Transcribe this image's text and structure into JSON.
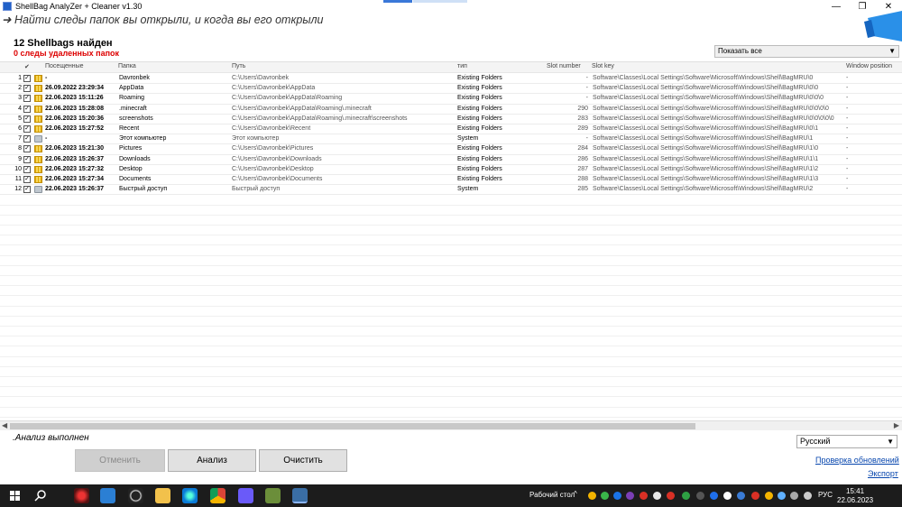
{
  "window": {
    "title": "ShellBag  AnalyZer + Cleaner v1.30",
    "minimize": "—",
    "maximize": "❐",
    "close": "✕"
  },
  "tagline": "➜ Найти следы папок вы открыли, и когда вы его открыли",
  "summary": {
    "found": "12 Shellbags найден",
    "deleted": "0  следы удаленных папок"
  },
  "filter": {
    "selected": "Показать все"
  },
  "grid": {
    "columns": {
      "check": "✔",
      "visited": "Посещенные",
      "folder": "Папка",
      "path": "Путь",
      "type": "тип",
      "slot_number": "Slot number",
      "slot_key": "Slot key",
      "window_position": "Window position"
    },
    "rows": [
      {
        "num": "1",
        "icon": "folder",
        "visited": "-",
        "folder": "Davronbek",
        "path": "C:\\Users\\Davronbek",
        "type": "Existing Folders",
        "slot": "-",
        "key": "Software\\Classes\\Local Settings\\Software\\Microsoft\\Windows\\Shell\\BagMRU\\0",
        "pos": "-"
      },
      {
        "num": "2",
        "icon": "folder",
        "visited": "26.09.2022 23:29:34",
        "folder": "AppData",
        "path": "C:\\Users\\Davronbek\\AppData",
        "type": "Existing Folders",
        "slot": "-",
        "key": "Software\\Classes\\Local Settings\\Software\\Microsoft\\Windows\\Shell\\BagMRU\\0\\0",
        "pos": "-"
      },
      {
        "num": "3",
        "icon": "folder",
        "visited": "22.06.2023 15:11:26",
        "folder": "Roaming",
        "path": "C:\\Users\\Davronbek\\AppData\\Roaming",
        "type": "Existing Folders",
        "slot": "-",
        "key": "Software\\Classes\\Local Settings\\Software\\Microsoft\\Windows\\Shell\\BagMRU\\0\\0\\0",
        "pos": "-"
      },
      {
        "num": "4",
        "icon": "folder",
        "visited": "22.06.2023 15:28:08",
        "folder": ".minecraft",
        "path": "C:\\Users\\Davronbek\\AppData\\Roaming\\.minecraft",
        "type": "Existing Folders",
        "slot": "290",
        "key": "Software\\Classes\\Local Settings\\Software\\Microsoft\\Windows\\Shell\\BagMRU\\0\\0\\0\\0",
        "pos": "-"
      },
      {
        "num": "5",
        "icon": "folder",
        "visited": "22.06.2023 15:20:36",
        "folder": "screenshots",
        "path": "C:\\Users\\Davronbek\\AppData\\Roaming\\.minecraft\\screenshots",
        "type": "Existing Folders",
        "slot": "283",
        "key": "Software\\Classes\\Local Settings\\Software\\Microsoft\\Windows\\Shell\\BagMRU\\0\\0\\0\\0\\0",
        "pos": "-"
      },
      {
        "num": "6",
        "icon": "folder",
        "visited": "22.06.2023 15:27:52",
        "folder": "Recent",
        "path": "C:\\Users\\Davronbek\\Recent",
        "type": "Existing Folders",
        "slot": "289",
        "key": "Software\\Classes\\Local Settings\\Software\\Microsoft\\Windows\\Shell\\BagMRU\\0\\1",
        "pos": "-"
      },
      {
        "num": "7",
        "icon": "sys",
        "visited": "-",
        "folder": "Этот компьютер",
        "path": "Этот компьютер",
        "type": "System",
        "slot": "-",
        "key": "Software\\Classes\\Local Settings\\Software\\Microsoft\\Windows\\Shell\\BagMRU\\1",
        "pos": "-"
      },
      {
        "num": "8",
        "icon": "folder",
        "visited": "22.06.2023 15:21:30",
        "folder": "Pictures",
        "path": "C:\\Users\\Davronbek\\Pictures",
        "type": "Existing Folders",
        "slot": "284",
        "key": "Software\\Classes\\Local Settings\\Software\\Microsoft\\Windows\\Shell\\BagMRU\\1\\0",
        "pos": "-"
      },
      {
        "num": "9",
        "icon": "folder",
        "visited": "22.06.2023 15:26:37",
        "folder": "Downloads",
        "path": "C:\\Users\\Davronbek\\Downloads",
        "type": "Existing Folders",
        "slot": "286",
        "key": "Software\\Classes\\Local Settings\\Software\\Microsoft\\Windows\\Shell\\BagMRU\\1\\1",
        "pos": "-"
      },
      {
        "num": "10",
        "icon": "folder",
        "visited": "22.06.2023 15:27:32",
        "folder": "Desktop",
        "path": "C:\\Users\\Davronbek\\Desktop",
        "type": "Existing Folders",
        "slot": "287",
        "key": "Software\\Classes\\Local Settings\\Software\\Microsoft\\Windows\\Shell\\BagMRU\\1\\2",
        "pos": "-"
      },
      {
        "num": "11",
        "icon": "folder",
        "visited": "22.06.2023 15:27:34",
        "folder": "Documents",
        "path": "C:\\Users\\Davronbek\\Documents",
        "type": "Existing Folders",
        "slot": "288",
        "key": "Software\\Classes\\Local Settings\\Software\\Microsoft\\Windows\\Shell\\BagMRU\\1\\3",
        "pos": "-"
      },
      {
        "num": "12",
        "icon": "sys",
        "visited": "22.06.2023 15:26:37",
        "folder": "Быстрый доступ",
        "path": "Быстрый доступ",
        "type": "System",
        "slot": "285",
        "key": "Software\\Classes\\Local Settings\\Software\\Microsoft\\Windows\\Shell\\BagMRU\\2",
        "pos": "-"
      }
    ]
  },
  "status": ".Анализ выполнен",
  "language": {
    "selected": "Русский"
  },
  "buttons": {
    "cancel": "Отменить",
    "analyze": "Анализ",
    "clean": "Очистить"
  },
  "links": {
    "update": "Проверка обновлений",
    "export": "Экспорт"
  },
  "taskbar": {
    "desktop_label": "Рабочий стол",
    "lang": "РУС",
    "time": "15:41",
    "date": "22.06.2023"
  }
}
